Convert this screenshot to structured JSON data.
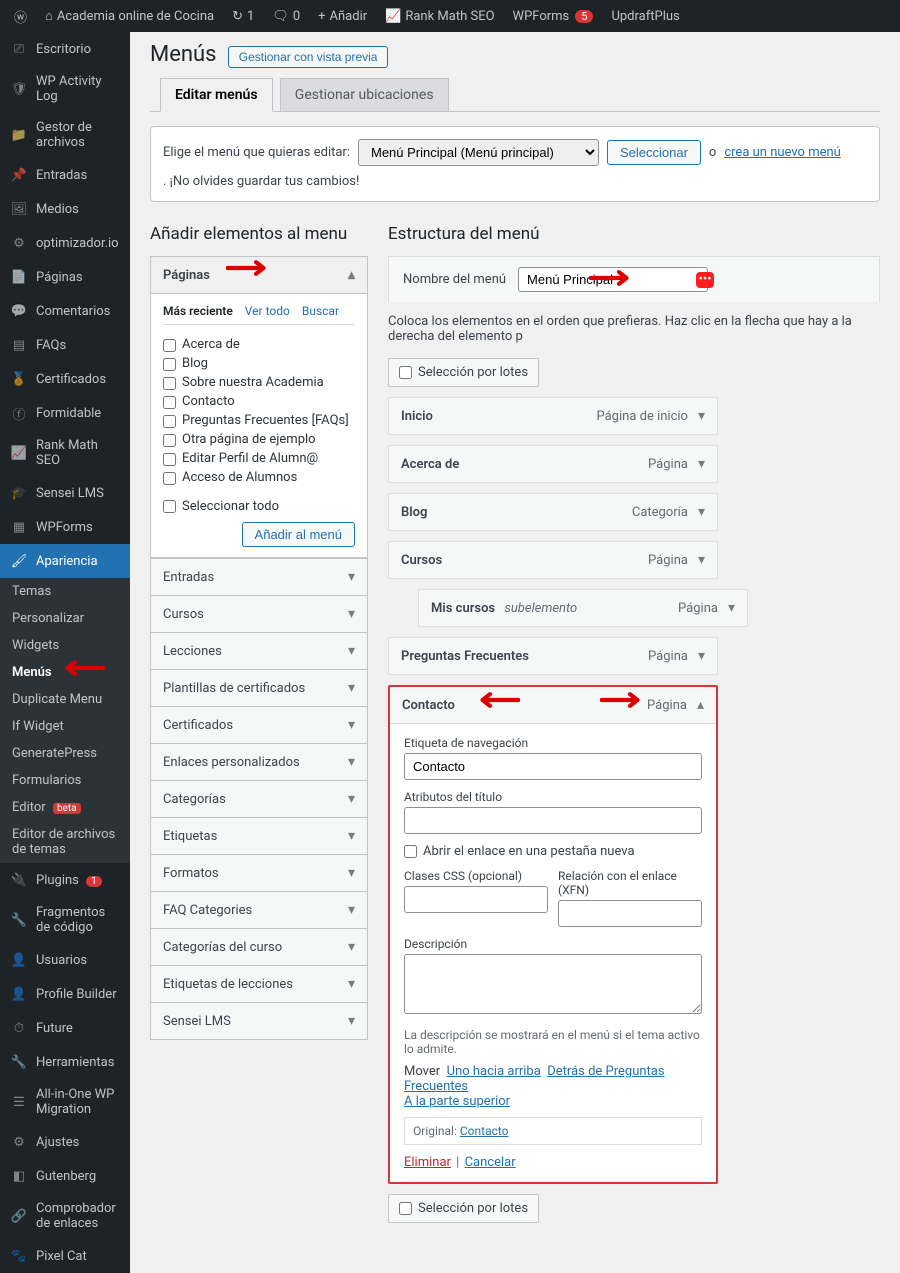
{
  "adminbar": {
    "site_name": "Academia online de Cocina",
    "updates": "1",
    "comments": "0",
    "add_new": "Añadir",
    "rank_math": "Rank Math SEO",
    "wpforms": "WPForms",
    "wpforms_count": "5",
    "updraft": "UpdraftPlus"
  },
  "sidebar": {
    "items": [
      {
        "label": "Escritorio",
        "icon": "⎚"
      },
      {
        "label": "WP Activity Log",
        "icon": "🛡"
      },
      {
        "label": "Gestor de archivos",
        "icon": "📁"
      },
      {
        "label": "Entradas",
        "icon": "📌"
      },
      {
        "label": "Medios",
        "icon": "🖼"
      },
      {
        "label": "optimizador.io",
        "icon": "⚙"
      },
      {
        "label": "Páginas",
        "icon": "📄"
      },
      {
        "label": "Comentarios",
        "icon": "💬"
      },
      {
        "label": "FAQs",
        "icon": "▤"
      },
      {
        "label": "Certificados",
        "icon": "🏅"
      },
      {
        "label": "Formidable",
        "icon": "ⓕ"
      },
      {
        "label": "Rank Math SEO",
        "icon": "📈"
      },
      {
        "label": "Sensei LMS",
        "icon": "🎓"
      },
      {
        "label": "WPForms",
        "icon": "▦"
      },
      {
        "label": "Apariencia",
        "icon": "🖌"
      }
    ],
    "appearance_sub": [
      "Temas",
      "Personalizar",
      "Widgets",
      "Menús",
      "Duplicate Menu",
      "If Widget",
      "GeneratePress",
      "Formularios",
      "Editor",
      "Editor de archivos de temas"
    ],
    "editor_beta": "beta",
    "items2": [
      {
        "label": "Plugins",
        "icon": "🔌",
        "badge": "1"
      },
      {
        "label": "Fragmentos de código",
        "icon": "🔧"
      },
      {
        "label": "Usuarios",
        "icon": "👤"
      },
      {
        "label": "Profile Builder",
        "icon": "👤"
      },
      {
        "label": "Future",
        "icon": "⏱"
      },
      {
        "label": "Herramientas",
        "icon": "🔧"
      },
      {
        "label": "All-in-One WP Migration",
        "icon": "☰"
      },
      {
        "label": "Ajustes",
        "icon": "⚙"
      },
      {
        "label": "Gutenberg",
        "icon": "◧"
      },
      {
        "label": "Comprobador de enlaces",
        "icon": "🔗"
      },
      {
        "label": "Pixel Cat",
        "icon": "🐾"
      }
    ]
  },
  "page": {
    "title": "Menús",
    "preview_btn": "Gestionar con vista previa",
    "tabs": {
      "edit": "Editar menús",
      "locations": "Gestionar ubicaciones"
    },
    "select_row": {
      "prefix": "Elige el menú que quieras editar:",
      "options": [
        "Menú Principal (Menú principal)"
      ],
      "select_btn": "Seleccionar",
      "or": "o",
      "create_link": "crea un nuevo menú",
      "suffix": ". ¡No olvides guardar tus cambios!"
    }
  },
  "left": {
    "heading": "Añadir elementos al menu",
    "pages_title": "Páginas",
    "sub_tabs": {
      "recent": "Más reciente",
      "all": "Ver todo",
      "search": "Buscar"
    },
    "page_items": [
      "Acerca de",
      "Blog",
      "Sobre nuestra Academia",
      "Contacto",
      "Preguntas Frecuentes [FAQs]",
      "Otra página de ejemplo",
      "Editar Perfil de Alumn@",
      "Acceso de Alumnos"
    ],
    "select_all": "Seleccionar todo",
    "add_btn": "Añadir al menú",
    "other_panels": [
      "Entradas",
      "Cursos",
      "Lecciones",
      "Plantillas de certificados",
      "Certificados",
      "Enlaces personalizados",
      "Categorías",
      "Etiquetas",
      "Formatos",
      "FAQ Categories",
      "Categorías del curso",
      "Etiquetas de lecciones",
      "Sensei LMS"
    ]
  },
  "right": {
    "heading": "Estructura del menú",
    "name_label": "Nombre del menú",
    "name_value": "Menú Principal",
    "desc": "Coloca los elementos en el orden que prefieras. Haz clic en la flecha que hay a la derecha del elemento p",
    "bulk": "Selección por lotes",
    "items": [
      {
        "title": "Inicio",
        "type": "Página de inicio"
      },
      {
        "title": "Acerca de",
        "type": "Página"
      },
      {
        "title": "Blog",
        "type": "Categoría"
      },
      {
        "title": "Cursos",
        "type": "Página"
      },
      {
        "title": "Mis cursos",
        "type": "Página",
        "sub": "subelemento",
        "child": true
      },
      {
        "title": "Preguntas Frecuentes",
        "type": "Página"
      }
    ],
    "open_item": {
      "title": "Contacto",
      "type": "Página",
      "nav_label": "Etiqueta de navegación",
      "nav_value": "Contacto",
      "title_attr": "Atributos del título",
      "new_tab": "Abrir el enlace en una pestaña nueva",
      "css": "Clases CSS (opcional)",
      "xfn": "Relación con el enlace (XFN)",
      "desc": "Descripción",
      "desc_help": "La descripción se mostrará en el menú si el tema activo lo admite.",
      "move": "Mover",
      "up": "Uno hacia arriba",
      "behind": "Detrás de Preguntas Frecuentes",
      "top": "A la parte superior",
      "original": "Original:",
      "original_link": "Contacto",
      "remove": "Eliminar",
      "cancel": "Cancelar"
    }
  }
}
